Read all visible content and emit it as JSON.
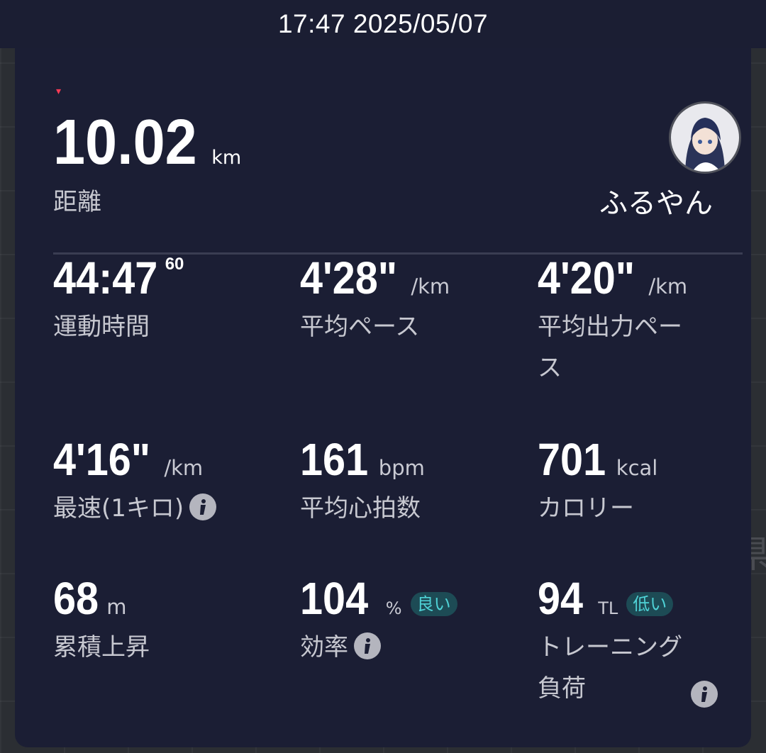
{
  "status_bar": {
    "timestamp": "17:47 2025/05/07"
  },
  "summary": {
    "distance": {
      "value": "10.02",
      "unit": "km",
      "label": "距離"
    },
    "user": {
      "name": "ふるやん"
    }
  },
  "stats": {
    "duration": {
      "value": "44:47",
      "fraction": "60",
      "label": "運動時間"
    },
    "avg_pace": {
      "value": "4'28\"",
      "unit": "/km",
      "label": "平均ペース"
    },
    "avg_power_pace": {
      "value": "4'20\"",
      "unit": "/km",
      "label_line1": "平均出力ペー",
      "label_line2": "ス"
    },
    "fastest_km": {
      "value": "4'16\"",
      "unit": "/km",
      "label": "最速(1キロ)"
    },
    "avg_heart_rate": {
      "value": "161",
      "unit": "bpm",
      "label": "平均心拍数"
    },
    "calories": {
      "value": "701",
      "unit": "kcal",
      "label": "カロリー"
    },
    "elevation_gain": {
      "value": "68",
      "unit": "m",
      "label": "累積上昇"
    },
    "efficiency": {
      "value": "104",
      "unit": "%",
      "badge": "良い",
      "label": "効率"
    },
    "training_load": {
      "value": "94",
      "unit": "TL",
      "badge": "低い",
      "label_line1": "トレーニング",
      "label_line2": "負荷"
    }
  },
  "colors": {
    "card_background": "#1b1e34",
    "badge_text": "#4fd2d6",
    "badge_background": "#1d4b55",
    "label_text": "#c7c8d0"
  },
  "icons": {
    "info": "info-icon",
    "avatar": "user-avatar"
  }
}
